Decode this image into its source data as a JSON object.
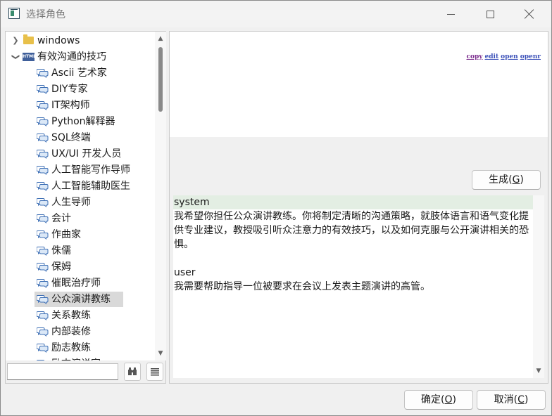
{
  "window": {
    "title": "选择角色"
  },
  "tree": {
    "root_folder": "windows",
    "group": "有效沟通的技巧",
    "items": [
      "Ascii 艺术家",
      "DIY专家",
      "IT架构师",
      "Python解释器",
      "SQL终端",
      "UX/UI 开发人员",
      "人工智能写作导师",
      "人工智能辅助医生",
      "人生导师",
      "会计",
      "作曲家",
      "侏儒",
      "保姆",
      "催眠治疗师",
      "公众演讲教练",
      "关系教练",
      "内部装修",
      "励志教练",
      "励志演说家"
    ],
    "selected": "公众演讲教练"
  },
  "filter": {
    "value": ""
  },
  "preview": {
    "links": [
      "copy",
      "edit",
      "open",
      "openr"
    ]
  },
  "generate_button": {
    "label": "生成(",
    "hotkey": "G",
    "suffix": ")"
  },
  "conversation": {
    "system_role": "system",
    "system_text": "我希望你担任公众演讲教练。你将制定清晰的沟通策略，就肢体语言和语气变化提供专业建议，教授吸引听众注意力的有效技巧，以及如何克服与公开演讲相关的恐惧。",
    "user_role": "user",
    "user_text": "我需要帮助指导一位被要求在会议上发表主题演讲的高管。"
  },
  "ok_button": {
    "label": "确定(",
    "hotkey": "O",
    "suffix": ")"
  },
  "cancel_button": {
    "label": "取消(",
    "hotkey": "C",
    "suffix": ")"
  }
}
